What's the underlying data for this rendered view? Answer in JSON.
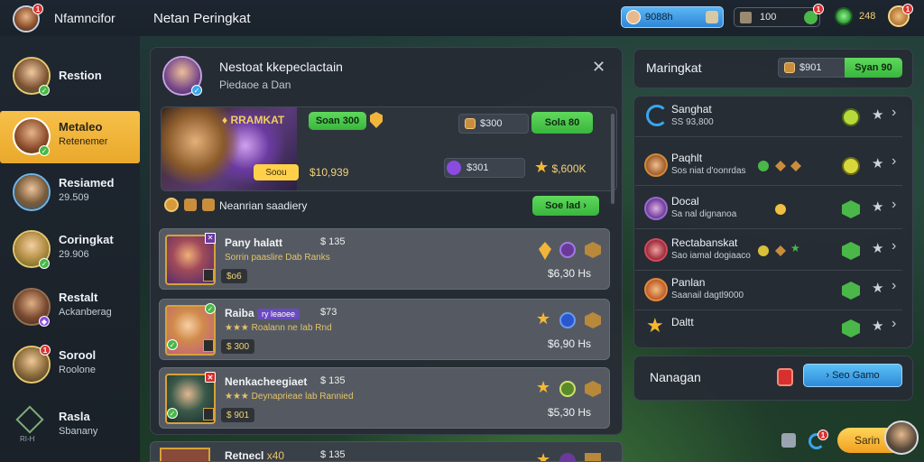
{
  "header": {
    "app_title": "Nfamncifor",
    "screen_title": "Netan Peringkat",
    "profile_badge": "1",
    "currency_blue": "9088h",
    "currency_dark": "100",
    "dark_badge": "1",
    "gem_value": "248",
    "corner_badge": "1"
  },
  "sidebar": {
    "items": [
      {
        "name": "Restion",
        "sub": ""
      },
      {
        "name": "Metaleo",
        "sub": "Retenemer"
      },
      {
        "name": "Resiamed",
        "sub": "29.509"
      },
      {
        "name": "Coringkat",
        "sub": "29.906"
      },
      {
        "name": "Restalt",
        "sub": "Ackanberag"
      },
      {
        "name": "Sorool",
        "sub": "Roolone"
      },
      {
        "name": "Rasla",
        "sub": "Sbanany"
      }
    ],
    "side_badge": "1",
    "small_code": "RI-H"
  },
  "main_panel": {
    "title": "Nestoat kkepeclactain",
    "subtitle": "Piedaoe a Dan",
    "hero_tag": "RRAMKAT",
    "hero_btn": "Soan 300",
    "hero_chip": "Soou",
    "hero_price": "$10,939",
    "pill_a": "$300",
    "pill_a_btn": "Sola 80",
    "pill_b": "$301",
    "pill_b_price": "$,600K",
    "info_text": "Neanrian saadiery",
    "see_btn": "Soe lad",
    "rows": [
      {
        "name": "Pany halatt",
        "sub": "Sorrin paaslire   Dab   Ranks",
        "chip": "$o6",
        "val": "$ 135",
        "price": "$6,30 Hs"
      },
      {
        "name": "Raiba",
        "tag": "ry leaoee",
        "sub": "★★★ Roalann ne   Iab   Rnd",
        "chip": "$ 300",
        "val": "$73",
        "price": "$6,90 Hs"
      },
      {
        "name": "Nenkacheegiaet",
        "sub": "★★★ Deynaprieae   lab   Rannied",
        "chip": "$ 901",
        "val": "$ 135",
        "price": "$5,30 Hs"
      },
      {
        "name": "Retnecl",
        "tag": "x40",
        "sub": "",
        "chip": "",
        "val": "$ 135",
        "price": ""
      }
    ]
  },
  "right_panel": {
    "title": "Maringkat",
    "pill": "$901",
    "pill_btn": "Syan 90",
    "rows": [
      {
        "name": "Sanghat",
        "sub": "SS 93,800"
      },
      {
        "name": "Paqhlt",
        "sub": "Sos niat d'oonrdas"
      },
      {
        "name": "Docal",
        "sub": "Sa nal dignanoa"
      },
      {
        "name": "Rectabanskat",
        "sub": "Sao iamal dogiaaco"
      },
      {
        "name": "Panlan",
        "sub": "Saanail dagtl9000"
      },
      {
        "name": "Daltt",
        "sub": ""
      }
    ],
    "bottom_label": "Nanagan",
    "bottom_btn": "Seo Gamo"
  },
  "footer": {
    "corner_btn": "Sarin",
    "notif_badge": "1"
  },
  "colors": {
    "accent_gold": "#f7c04a",
    "green": "#46b847",
    "panel": "#262c34",
    "blue": "#3aa6ee"
  }
}
